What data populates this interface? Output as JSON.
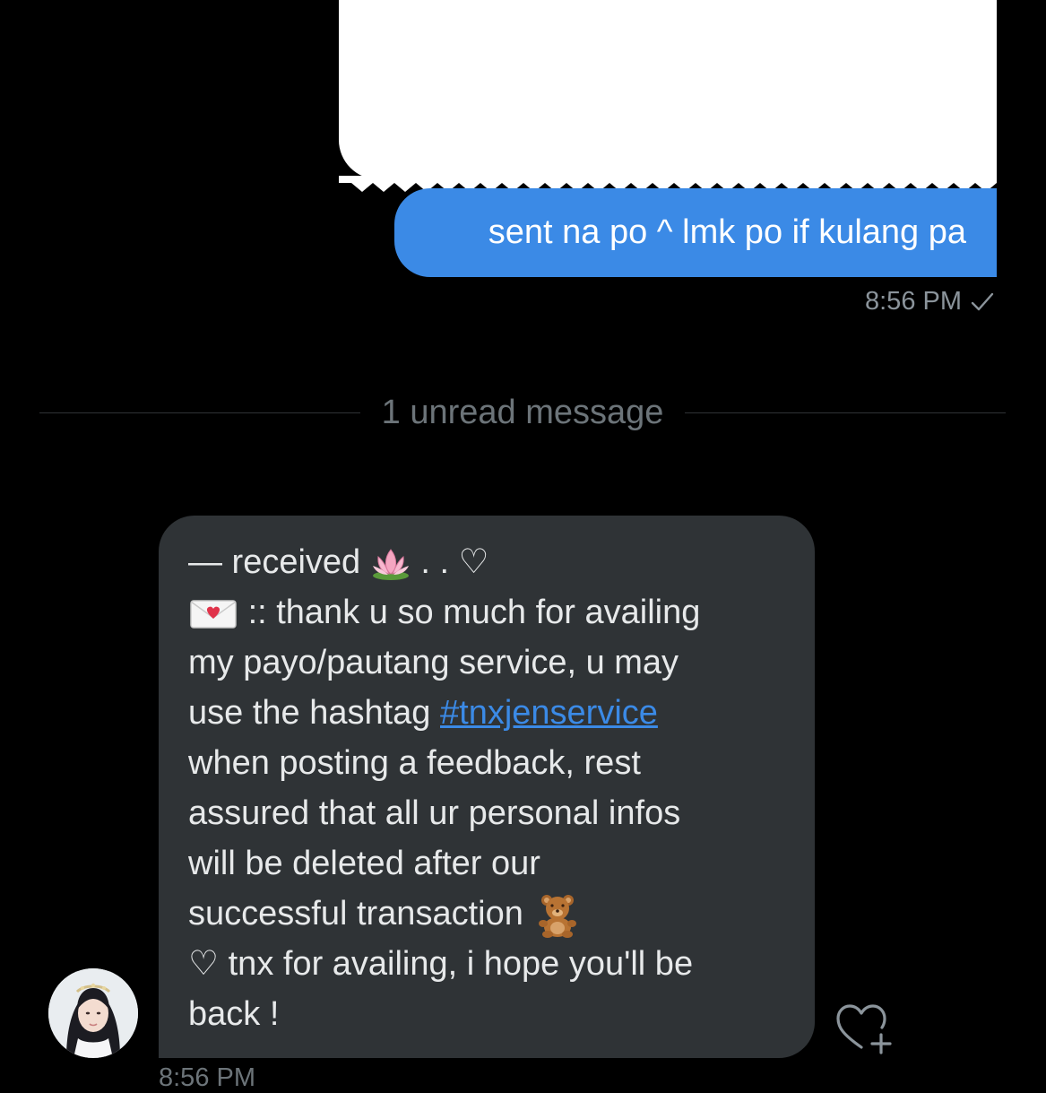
{
  "sent_message": {
    "text": "sent na po ^ lmk po if kulang pa",
    "time": "8:56 PM"
  },
  "divider": {
    "label": "1 unread message"
  },
  "received_message": {
    "line1_text": "— received",
    "line1_suffix": " . . ♡",
    "line2_text": " :: thank u so much for availing",
    "line3_text": "my payo/pautang service, u may",
    "line4_prefix": "use the hashtag ",
    "line4_hashtag": "#tnxjenservice",
    "line5_text": "when posting a feedback, rest",
    "line6_text": "assured that all ur personal infos",
    "line7_text": "will be deleted after our",
    "line8_text": "successful transaction",
    "line9_text": "♡ tnx for availing, i hope you'll be",
    "line10_text": "back !",
    "time_partial": "8:56 PM"
  },
  "colors": {
    "accent": "#3b8ae6",
    "received_bubble": "#2f3336",
    "background": "#000000",
    "muted_text": "#8b949b"
  },
  "icons": [
    "check-icon",
    "lotus-emoji",
    "love-letter-emoji",
    "teddy-bear-emoji",
    "heart-plus-icon",
    "avatar"
  ]
}
